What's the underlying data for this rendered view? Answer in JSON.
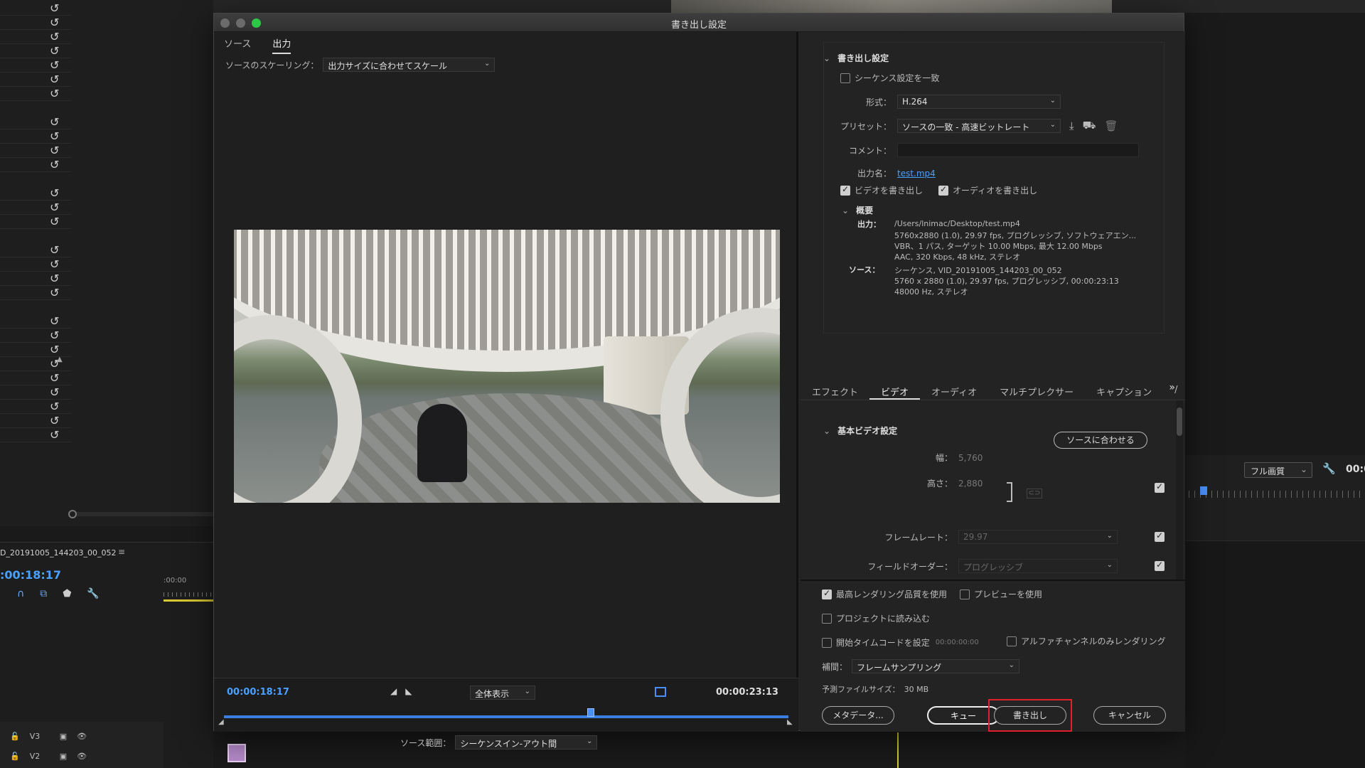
{
  "dialog": {
    "title": "書き出し設定",
    "left_tabs": [
      "ソース",
      "出力"
    ],
    "scaling_label": "ソースのスケーリング：",
    "scaling_value": "出力サイズに合わせてスケール",
    "current_time": "00:00:18:17",
    "zoom_value": "全体表示",
    "end_time": "00:00:23:13",
    "source_range_label": "ソース範囲：",
    "source_range_value": "シーケンスイン-アウト間",
    "playhead_fraction": 0.65
  },
  "export_settings": {
    "section_title": "書き出し設定",
    "match_sequence": "シーケンス設定を一致",
    "format_label": "形式：",
    "format_value": "H.264",
    "preset_label": "プリセット：",
    "preset_value": "ソースの一致 - 高速ビットレート",
    "comment_label": "コメント：",
    "output_name_label": "出力名：",
    "output_name_value": "test.mp4",
    "export_video": "ビデオを書き出し",
    "export_audio": "オーディオを書き出し",
    "summary_title": "概要",
    "summary_output_key": "出力：",
    "summary_output_lines": [
      "/Users/lnimac/Desktop/test.mp4",
      "5760x2880 (1.0), 29.97 fps, プログレッシブ, ソフトウェアエン...",
      "VBR、1 パス, ターゲット 10.00 Mbps, 最大 12.00 Mbps",
      "AAC, 320 Kbps, 48 kHz, ステレオ"
    ],
    "summary_source_key": "ソース：",
    "summary_source_lines": [
      "シーケンス, VID_20191005_144203_00_052",
      "5760 x 2880 (1.0), 29.97 fps, プログレッシブ, 00:00:23:13",
      "48000 Hz, ステレオ"
    ]
  },
  "tabs": [
    "エフェクト",
    "ビデオ",
    "オーディオ",
    "マルチプレクサー",
    "キャプション",
    "/"
  ],
  "basic_video": {
    "title": "基本ビデオ設定",
    "match_source": "ソースに合わせる",
    "width_label": "幅：",
    "width_value": "5,760",
    "height_label": "高さ：",
    "height_value": "2,880",
    "framerate_label": "フレームレート：",
    "framerate_value": "29.97",
    "field_order_label": "フィールドオーダー：",
    "field_order_value": "プログレッシブ"
  },
  "bottom": {
    "max_quality": "最高レンダリング品質を使用",
    "use_preview": "プレビューを使用",
    "import_project": "プロジェクトに読み込む",
    "set_start_tc": "開始タイムコードを設定",
    "start_tc_value": "00:00:00:00",
    "alpha_only": "アルファチャンネルのみレンダリング",
    "interp_label": "補間：",
    "interp_value": "フレームサンプリング",
    "filesize_label": "予測ファイルサイズ：",
    "filesize_value": "30 MB",
    "metadata_btn": "メタデータ...",
    "queue_btn": "キュー",
    "export_btn": "書き出し",
    "cancel_btn": "キャンセル"
  },
  "background": {
    "sequence_name": "D_20191005_144203_00_052",
    "timeline_time": ":00:18:17",
    "ruler_label": ":00:00",
    "track_v3": "V3",
    "track_v2": "V2",
    "quality": "フル画質",
    "right_time": "00:0"
  },
  "colors": {
    "accent_blue": "#4aa0ff",
    "highlight_red": "#e0202a",
    "maximize_green": "#2ec848"
  }
}
